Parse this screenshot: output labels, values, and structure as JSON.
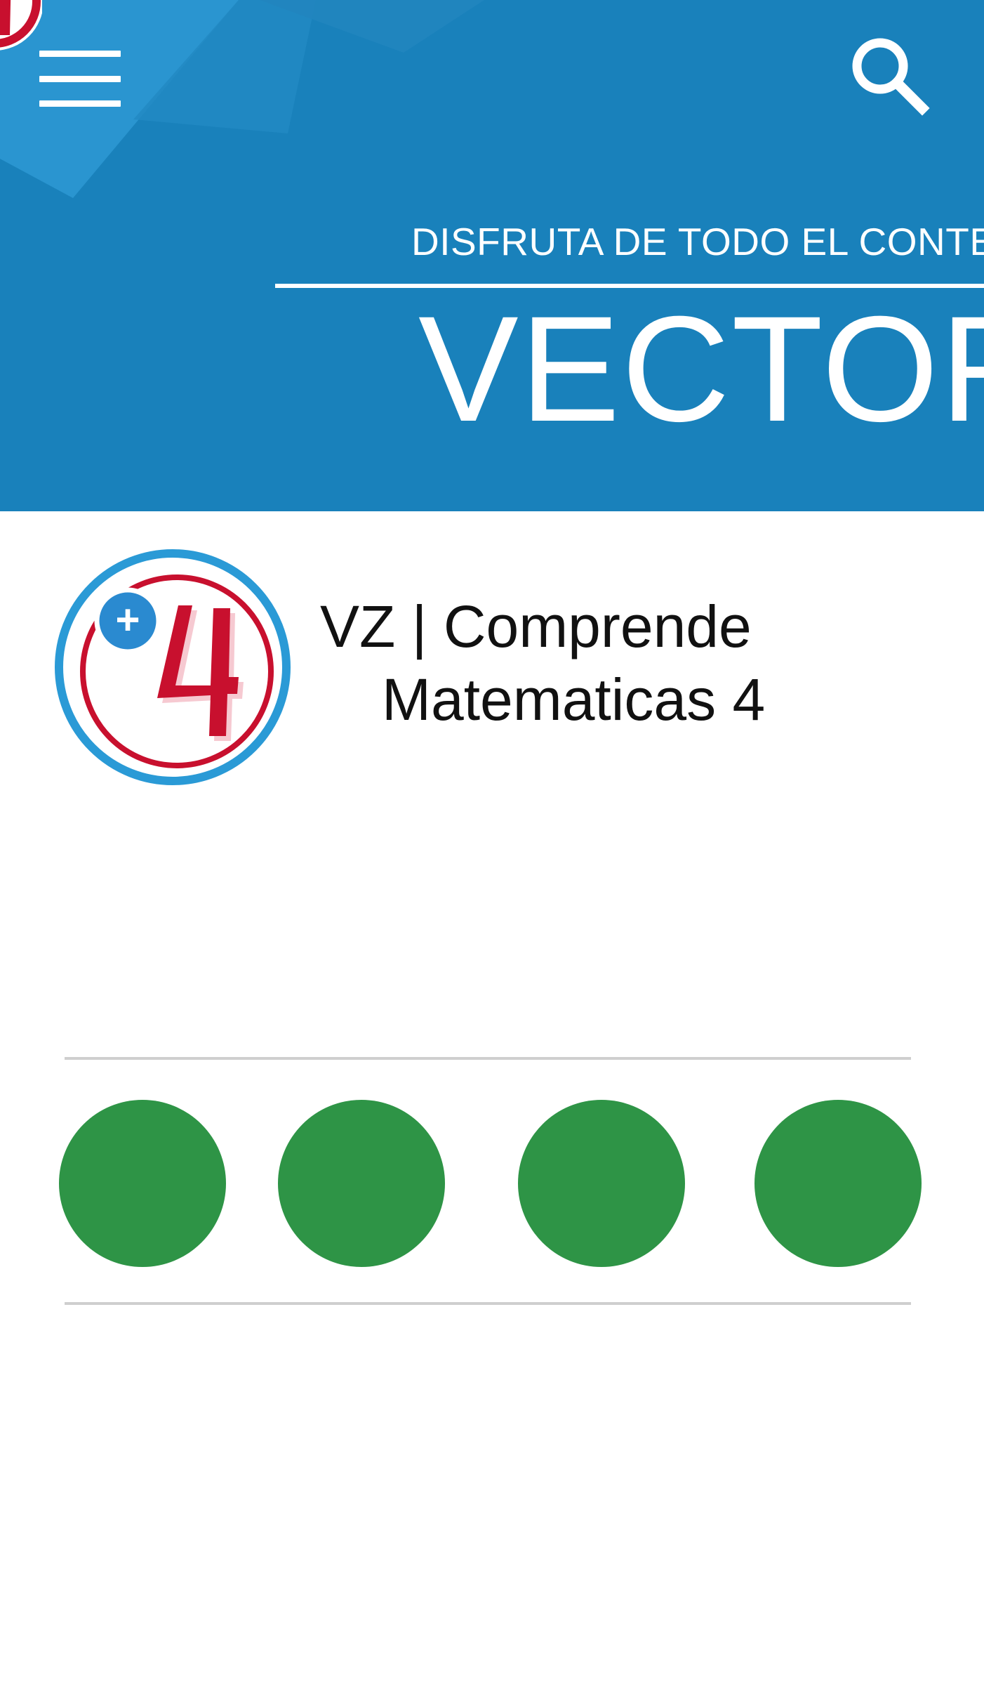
{
  "header": {
    "subtitle": "DISFRUTA DE TODO EL CONTEN",
    "title": "VECTOR"
  },
  "icons": {
    "menu": "hamburger-menu-icon",
    "search": "search-icon",
    "brand": "plus-four-logo-icon"
  },
  "product": {
    "title_line1": "VZ | Comprende",
    "title_line2": "Matematicas 4",
    "logo_badge": "+",
    "logo_number": "4"
  },
  "dots": [
    {
      "color": "#2e9446"
    },
    {
      "color": "#2e9446"
    },
    {
      "color": "#2e9446"
    },
    {
      "color": "#2e9446"
    }
  ],
  "colors": {
    "header_blue": "#1981bb",
    "logo_blue": "#2a9ad6",
    "logo_red": "#c8102e",
    "dot_green": "#2e9446",
    "divider_grey": "#cfcfcf"
  }
}
